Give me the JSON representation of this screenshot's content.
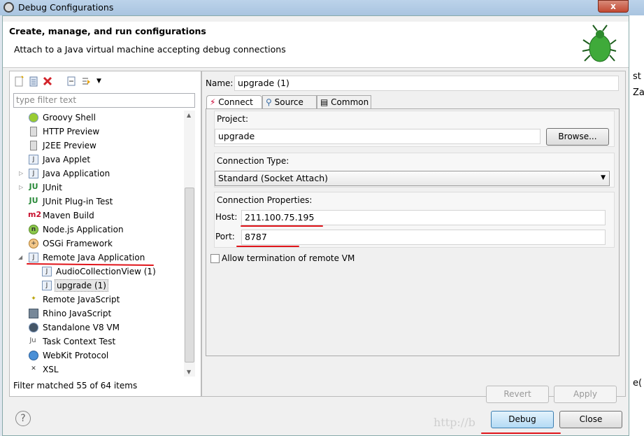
{
  "window": {
    "title": "Debug Configurations",
    "close": "x"
  },
  "header": {
    "title": "Create, manage, and run configurations",
    "subtitle": "Attach to a Java virtual machine accepting debug connections"
  },
  "left": {
    "filter_placeholder": "type filter text",
    "status": "Filter matched 55 of 64 items",
    "tree": [
      {
        "label": "Groovy Shell",
        "icon": "groovy-icon"
      },
      {
        "label": "HTTP Preview",
        "icon": "server-icon"
      },
      {
        "label": "J2EE Preview",
        "icon": "server-icon"
      },
      {
        "label": "Java Applet",
        "icon": "applet-icon"
      },
      {
        "label": "Java Application",
        "icon": "java-app-icon"
      },
      {
        "label": "JUnit",
        "icon": "junit-icon"
      },
      {
        "label": "JUnit Plug-in Test",
        "icon": "junit-plugin-icon"
      },
      {
        "label": "Maven Build",
        "icon": "maven-icon"
      },
      {
        "label": "Node.js Application",
        "icon": "nodejs-icon"
      },
      {
        "label": "OSGi Framework",
        "icon": "osgi-icon"
      },
      {
        "label": "Remote Java Application",
        "icon": "remote-java-icon"
      },
      {
        "label": "AudioCollectionView (1)",
        "icon": "remote-java-icon"
      },
      {
        "label": "upgrade (1)",
        "icon": "remote-java-icon"
      },
      {
        "label": "Remote JavaScript",
        "icon": "js-icon"
      },
      {
        "label": "Rhino JavaScript",
        "icon": "rhino-icon"
      },
      {
        "label": "Standalone V8 VM",
        "icon": "v8-icon"
      },
      {
        "label": "Task Context Test",
        "icon": "task-icon"
      },
      {
        "label": "WebKit Protocol",
        "icon": "webkit-icon"
      },
      {
        "label": "XSL",
        "icon": "xsl-icon"
      }
    ]
  },
  "right": {
    "name_label": "Name:",
    "name_value": "upgrade (1)",
    "tabs": [
      "Connect",
      "Source",
      "Common"
    ],
    "project_label": "Project:",
    "project_value": "upgrade",
    "browse": "Browse...",
    "conn_type_label": "Connection Type:",
    "conn_type_value": "Standard (Socket Attach)",
    "conn_props_label": "Connection Properties:",
    "host_label": "Host:",
    "host_value": "211.100.75.195",
    "port_label": "Port:",
    "port_value": "8787",
    "allow_termination": "Allow termination of remote VM",
    "allow_termination_checked": false,
    "revert": "Revert",
    "apply": "Apply"
  },
  "footer": {
    "debug": "Debug",
    "close": "Close",
    "help": "?",
    "watermark": "http://b"
  },
  "side": {
    "t1": "st",
    "t2": "Za",
    "t3": "e("
  },
  "colors": {
    "annotation": "#e0141a",
    "debug_button": "#bfe0f7"
  }
}
